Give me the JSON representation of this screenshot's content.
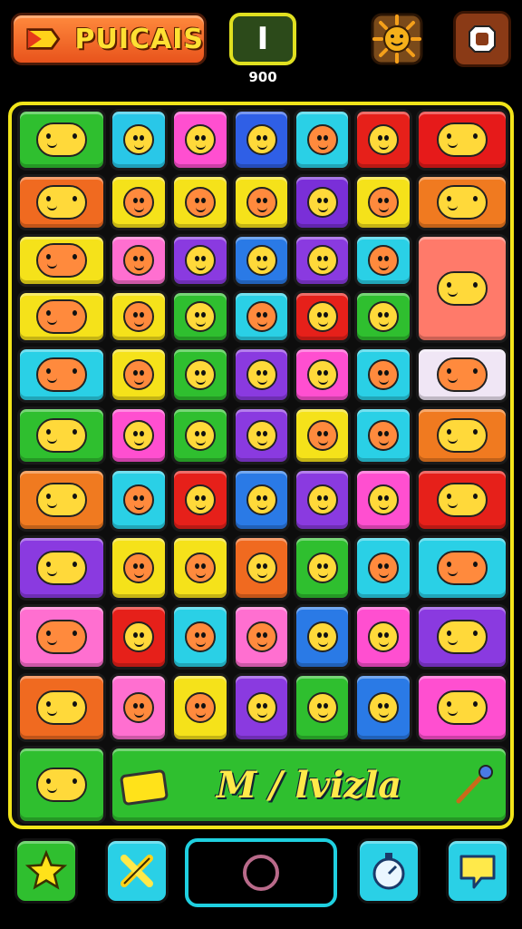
{
  "header": {
    "title": "PUICAIS",
    "level_value": "I",
    "score_value": "900"
  },
  "banner": {
    "text": "M / lvizla"
  },
  "tiles": [
    {
      "icon": "fish-icon",
      "color": "#2fbf2f"
    },
    {
      "icon": "creature-icon",
      "color": "#29c7e8"
    },
    {
      "icon": "cat-face-icon",
      "color": "#ff4fd0"
    },
    {
      "icon": "red-face-icon",
      "color": "#2f5fe6"
    },
    {
      "icon": "smile-face-icon",
      "color": "#2ad0e6"
    },
    {
      "icon": "balloon-icon",
      "color": "#e6201a"
    },
    {
      "icon": "sparkle-face-icon",
      "color": "#e61a1a"
    },
    {
      "icon": "radio-icon",
      "color": "#f06a20"
    },
    {
      "icon": "cat-face-icon",
      "color": "#f5e21a"
    },
    {
      "icon": "strawberry-icon",
      "color": "#f5e21a"
    },
    {
      "icon": "cat-face-icon",
      "color": "#f5e21a"
    },
    {
      "icon": "crayon-icon",
      "color": "#7a2fd8"
    },
    {
      "icon": "eraser-icon",
      "color": "#f5e21a"
    },
    {
      "icon": "camera-icon",
      "color": "#f07a20"
    },
    {
      "icon": "tools-icon",
      "color": "#f5e21a"
    },
    {
      "icon": "crystal-icon",
      "color": "#ff6fd0"
    },
    {
      "icon": "purple-face-icon",
      "color": "#8a3ae0"
    },
    {
      "icon": "cat-face-icon",
      "color": "#2a7ae6"
    },
    {
      "icon": "bird-icon",
      "color": "#8a3ae0"
    },
    {
      "icon": "smile-face-icon",
      "color": "#2ad0e6"
    },
    {
      "icon": "shoe-icon",
      "color": "#ff7a6a"
    },
    {
      "icon": "hand-icon",
      "color": "#f5e21a"
    },
    {
      "icon": "fire-face-icon",
      "color": "#f5e21a"
    },
    {
      "icon": "red-face-icon",
      "color": "#2fbf2f"
    },
    {
      "icon": "hat-face-icon",
      "color": "#2ad0e6"
    },
    {
      "icon": "white-cat-icon",
      "color": "#e6201a"
    },
    {
      "icon": "device-icon",
      "color": "#2fbf2f"
    },
    {
      "icon": "whale-icon",
      "color": "#2ad0e6"
    },
    {
      "icon": "frog-icon",
      "color": "#f5e21a"
    },
    {
      "icon": "bug-icon",
      "color": "#2fbf2f"
    },
    {
      "icon": "gear-icon",
      "color": "#8a3ae0"
    },
    {
      "icon": "chick-icon",
      "color": "#ff4fd0"
    },
    {
      "icon": "red-face-icon",
      "color": "#2ad0e6"
    },
    {
      "icon": "toy-car-icon",
      "color": "#f0e6f5"
    },
    {
      "icon": "fish-icon",
      "color": "#2fbf2f"
    },
    {
      "icon": "blue-ball-icon",
      "color": "#ff4fd0"
    },
    {
      "icon": "chick-icon",
      "color": "#2fbf2f"
    },
    {
      "icon": "red-face-icon",
      "color": "#8a3ae0"
    },
    {
      "icon": "green-face-icon",
      "color": "#f5e21a"
    },
    {
      "icon": "bread-icon",
      "color": "#2ad0e6"
    },
    {
      "icon": "shark-icon",
      "color": "#f07a20"
    },
    {
      "icon": "fox-icon",
      "color": "#f07a20"
    },
    {
      "icon": "monster-icon",
      "color": "#2ad0e6"
    },
    {
      "icon": "flame-icon",
      "color": "#e6201a"
    },
    {
      "icon": "robot-icon",
      "color": "#2a7ae6"
    },
    {
      "icon": "egg-face-icon",
      "color": "#8a3ae0"
    },
    {
      "icon": "star-blob-icon",
      "color": "#ff4fd0"
    },
    {
      "icon": "lion-face-icon",
      "color": "#e6201a"
    },
    {
      "icon": "palm-icon",
      "color": "#8a3ae0"
    },
    {
      "icon": "popsicle-icon",
      "color": "#f5e21a"
    },
    {
      "icon": "pen-icon",
      "color": "#f5e21a"
    },
    {
      "icon": "tree-icon",
      "color": "#f06a20"
    },
    {
      "icon": "lemon-icon",
      "color": "#2fbf2f"
    },
    {
      "icon": "juice-icon",
      "color": "#2ad0e6"
    },
    {
      "icon": "mug-icon",
      "color": "#2ad0e6"
    },
    {
      "icon": "leaf-icon",
      "color": "#ff6fd0"
    },
    {
      "icon": "cat-face-icon",
      "color": "#e6201a"
    },
    {
      "icon": "candy-icon",
      "color": "#2ad0e6"
    },
    {
      "icon": "bird-icon",
      "color": "#ff6fd0"
    },
    {
      "icon": "pencil-icon",
      "color": "#2a7ae6"
    },
    {
      "icon": "apple-icon",
      "color": "#ff4fd0"
    },
    {
      "icon": "meter-icon",
      "color": "#8a3ae0"
    },
    {
      "icon": "elephant-icon",
      "color": "#f06a20"
    },
    {
      "icon": "magnifier-icon",
      "color": "#ff6fd0"
    },
    {
      "icon": "sun-face-icon",
      "color": "#f5e21a"
    },
    {
      "icon": "pencil-icon",
      "color": "#8a3ae0"
    },
    {
      "icon": "potion-icon",
      "color": "#2fbf2f"
    },
    {
      "icon": "pumpkin-face-icon",
      "color": "#2a7ae6"
    },
    {
      "icon": "ticket-icon",
      "color": "#ff4fd0"
    },
    {
      "icon": "dolphin-icon",
      "color": "#2fbf2f"
    },
    {
      "icon": "banner-tile",
      "color": "#2fbf2f"
    }
  ],
  "dock": [
    {
      "icon": "star-icon",
      "color": "#2fbf2f"
    },
    {
      "icon": "tools-icon",
      "color": "#2ad0e6"
    },
    {
      "icon": "timer-icon",
      "color": "#2ad0e6"
    },
    {
      "icon": "chat-icon",
      "color": "#2ad0e6"
    }
  ]
}
